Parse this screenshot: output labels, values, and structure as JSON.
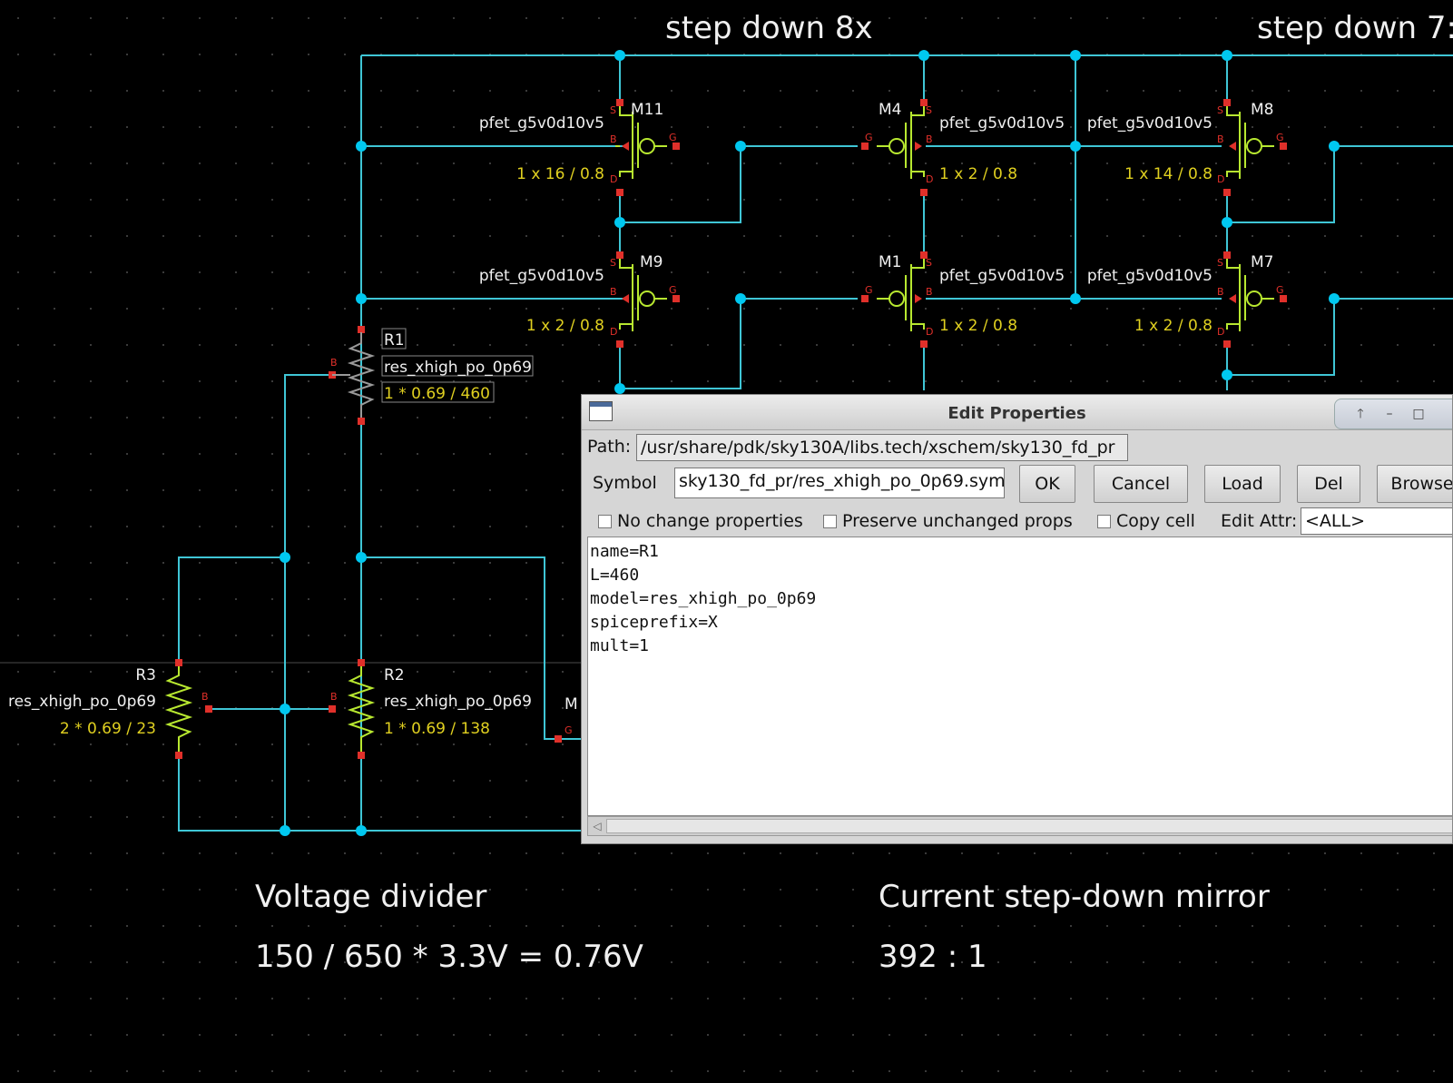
{
  "schematic": {
    "headings": {
      "step_down_8x": "step down 8x",
      "step_down_7": "step down 7:"
    },
    "transistors": [
      {
        "name": "M11",
        "model": "pfet_g5v0d10v5",
        "size": "1 x 16 / 0.8"
      },
      {
        "name": "M4",
        "model": "pfet_g5v0d10v5",
        "size": "1 x 2 / 0.8"
      },
      {
        "name": "M8",
        "model": "pfet_g5v0d10v5",
        "size": "1 x 14 / 0.8"
      },
      {
        "name": "M9",
        "model": "pfet_g5v0d10v5",
        "size": "1 x 2 / 0.8"
      },
      {
        "name": "M1",
        "model": "pfet_g5v0d10v5",
        "size": "1 x 2 / 0.8"
      },
      {
        "name": "M7",
        "model": "pfet_g5v0d10v5",
        "size": "1 x 2 / 0.8"
      }
    ],
    "resistors": [
      {
        "name": "R1",
        "model": "res_xhigh_po_0p69",
        "value": "1 * 0.69 / 460"
      },
      {
        "name": "R2",
        "model": "res_xhigh_po_0p69",
        "value": "1 * 0.69 / 138"
      },
      {
        "name": "R3",
        "model": "res_xhigh_po_0p69",
        "value": "2 * 0.69 / 23"
      }
    ],
    "partial_label": "M",
    "pin_labels": {
      "source": "S",
      "drain": "D",
      "gate": "G",
      "bulk": "B"
    },
    "annotations": {
      "voltage_divider_title": "Voltage divider",
      "voltage_divider_formula": "150 / 650 * 3.3V = 0.76V",
      "mirror_title": "Current step-down mirror",
      "mirror_ratio": "392 : 1"
    },
    "colors": {
      "wire": "#3fc6d6",
      "node": "#00c8f0",
      "pin": "#e0302a",
      "text": "#f0f0f0",
      "value": "#e0d020",
      "device": "#b8e830",
      "grid": "#3a3a3a"
    }
  },
  "dialog": {
    "title": "Edit Properties",
    "path_label": "Path:",
    "path_value": "/usr/share/pdk/sky130A/libs.tech/xschem/sky130_fd_pr",
    "symbol_label": "Symbol",
    "symbol_value": "sky130_fd_pr/res_xhigh_po_0p69.sym",
    "buttons": {
      "ok": "OK",
      "cancel": "Cancel",
      "load": "Load",
      "del": "Del",
      "browse": "Browse"
    },
    "checkboxes": {
      "no_change": "No change properties",
      "preserve": "Preserve unchanged props",
      "copy_cell": "Copy cell"
    },
    "edit_attr_label": "Edit Attr:",
    "edit_attr_value": "<ALL>",
    "properties": [
      "name=R1",
      "L=460",
      "model=res_xhigh_po_0p69",
      "spiceprefix=X",
      "mult=1"
    ]
  }
}
